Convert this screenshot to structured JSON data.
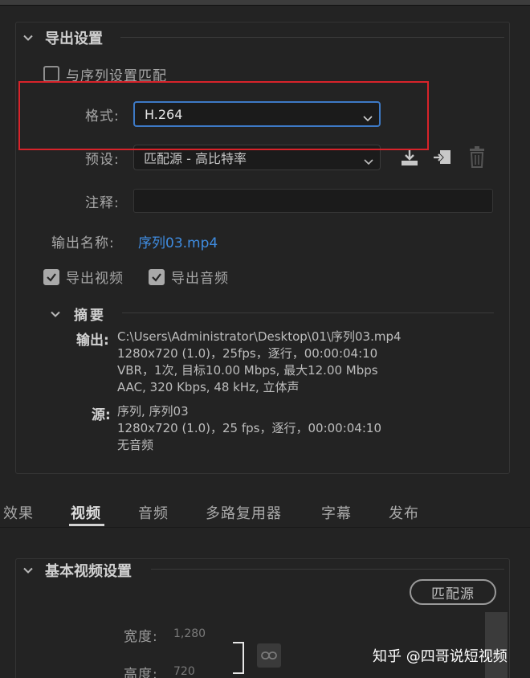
{
  "export_settings": {
    "title": "导出设置",
    "match_sequence_label": "与序列设置匹配",
    "match_sequence_checked": false,
    "format": {
      "label": "格式:",
      "value": "H.264"
    },
    "preset": {
      "label": "预设:",
      "value": "匹配源 - 高比特率"
    },
    "comment": {
      "label": "注释:",
      "value": ""
    },
    "output_name": {
      "label": "输出名称:",
      "value": "序列03.mp4"
    },
    "export_video": {
      "label": "导出视频",
      "checked": true
    },
    "export_audio": {
      "label": "导出音频",
      "checked": true
    },
    "icons": [
      "save-preset-icon",
      "import-preset-icon",
      "delete-preset-icon"
    ]
  },
  "summary": {
    "title": "摘要",
    "output_key": "输出:",
    "output_lines": [
      "C:\\Users\\Administrator\\Desktop\\01\\序列03.mp4",
      "1280x720 (1.0)，25fps，逐行，00:00:04:10",
      "VBR，1次, 目标10.00 Mbps, 最大12.00 Mbps",
      "AAC, 320 Kbps, 48  kHz, 立体声"
    ],
    "source_key": "源:",
    "source_lines": [
      "序列, 序列03",
      "1280x720 (1.0)，25 fps，逐行，00:00:04:10",
      "无音频"
    ]
  },
  "tabs": [
    {
      "label": "效果",
      "active": false
    },
    {
      "label": "视频",
      "active": true
    },
    {
      "label": "音频",
      "active": false
    },
    {
      "label": "多路复用器",
      "active": false
    },
    {
      "label": "字幕",
      "active": false
    },
    {
      "label": "发布",
      "active": false
    }
  ],
  "basic_video": {
    "title": "基本视频设置",
    "match_source_button": "匹配源",
    "width": {
      "label": "宽度:",
      "value": "1,280"
    },
    "height": {
      "label": "高度:",
      "value": "720"
    }
  },
  "watermark": "知乎 @四哥说短视频",
  "colors": {
    "accent": "#3d79c5",
    "highlight_box": "#d8232a",
    "link": "#3f8ce0"
  }
}
